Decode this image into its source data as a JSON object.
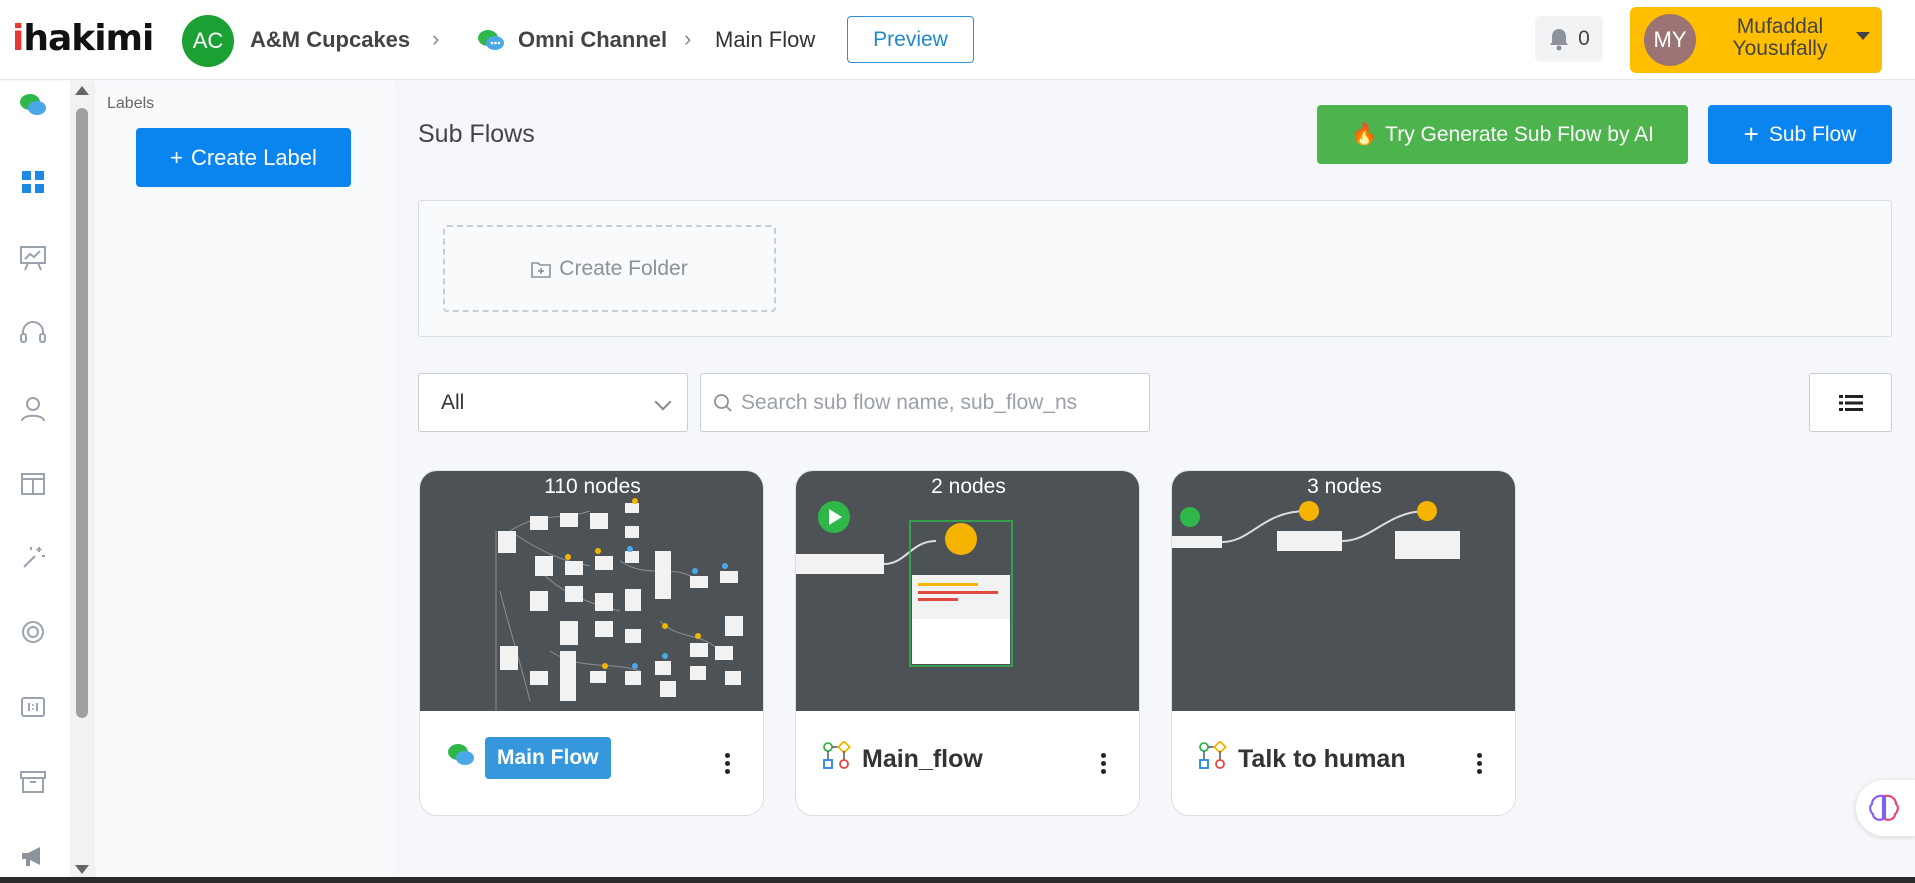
{
  "header": {
    "logo": "hakimi",
    "logo_i": "i",
    "workspace_initials": "AC",
    "workspace_name": "A&M Cupcakes",
    "channel": "Omni Channel",
    "flow": "Main Flow",
    "preview_label": "Preview",
    "notifications": "0",
    "user_initials": "MY",
    "user_name": "Mufaddal Yousufally"
  },
  "labels_panel": {
    "title": "Labels",
    "create_label": "Create Label"
  },
  "main": {
    "title": "Sub Flows",
    "ai_button": "Try Generate Sub Flow by AI",
    "add_subflow": "Sub Flow",
    "create_folder": "Create Folder",
    "filter_value": "All",
    "search_placeholder": "Search sub flow name, sub_flow_ns"
  },
  "cards": [
    {
      "nodes": "110 nodes",
      "name": "Main Flow",
      "icon": "chat-bubbles-icon",
      "highlighted": true
    },
    {
      "nodes": "2 nodes",
      "name": "Main_flow",
      "icon": "flow-diagram-icon",
      "highlighted": false
    },
    {
      "nodes": "3 nodes",
      "name": "Talk to human",
      "icon": "flow-diagram-icon",
      "highlighted": false
    }
  ],
  "colors": {
    "primary": "#0a85f0",
    "ai_green": "#4cb34d",
    "user_yellow": "#ffbf00",
    "workspace_green": "#1aa033",
    "preview_bg": "#4d5257"
  }
}
